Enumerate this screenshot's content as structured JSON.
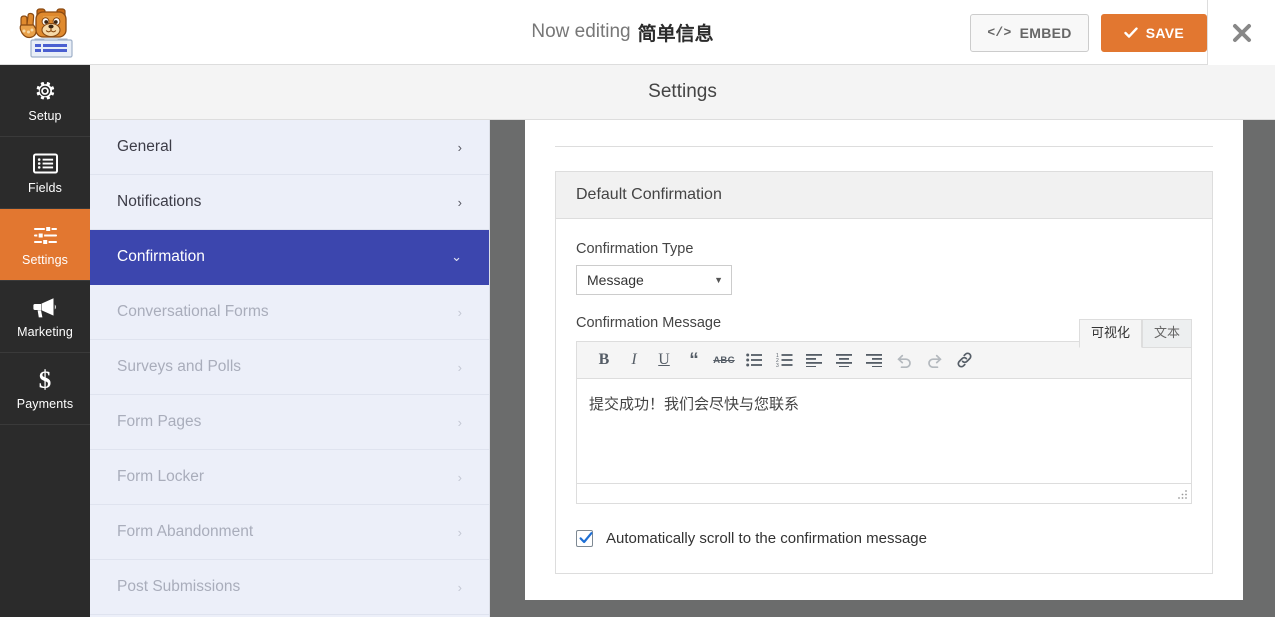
{
  "header": {
    "logo_icon": "wpforms-bear-logo",
    "editing_prefix": "Now editing",
    "form_name": "简单信息",
    "embed_label": "EMBED",
    "embed_icon": "code-icon",
    "save_label": "SAVE",
    "save_icon": "check-icon",
    "close_icon": "close-icon",
    "accent_color": "#e27730"
  },
  "rail": {
    "items": [
      {
        "label": "Setup",
        "icon": "gear-icon",
        "active": false
      },
      {
        "label": "Fields",
        "icon": "list-icon",
        "active": false
      },
      {
        "label": "Settings",
        "icon": "sliders-icon",
        "active": true
      },
      {
        "label": "Marketing",
        "icon": "megaphone-icon",
        "active": false
      },
      {
        "label": "Payments",
        "icon": "dollar-icon",
        "active": false
      }
    ]
  },
  "settings_header": {
    "title": "Settings"
  },
  "settings_menu": {
    "active_color": "#3c46ae",
    "items": [
      {
        "label": "General",
        "state": "enabled",
        "chevron": "›"
      },
      {
        "label": "Notifications",
        "state": "enabled",
        "chevron": "›"
      },
      {
        "label": "Confirmation",
        "state": "active",
        "chevron": "⌄"
      },
      {
        "label": "Conversational Forms",
        "state": "disabled",
        "chevron": "›"
      },
      {
        "label": "Surveys and Polls",
        "state": "disabled",
        "chevron": "›"
      },
      {
        "label": "Form Pages",
        "state": "disabled",
        "chevron": "›"
      },
      {
        "label": "Form Locker",
        "state": "disabled",
        "chevron": "›"
      },
      {
        "label": "Form Abandonment",
        "state": "disabled",
        "chevron": "›"
      },
      {
        "label": "Post Submissions",
        "state": "disabled",
        "chevron": "›"
      }
    ]
  },
  "confirmation": {
    "card_title": "Default Confirmation",
    "type_label": "Confirmation Type",
    "type_value": "Message",
    "type_caret": "▼",
    "message_label": "Confirmation Message",
    "editor": {
      "tab_visual": "可视化",
      "tab_text": "文本",
      "active_tab": "可视化",
      "content": "提交成功！我们会尽快与您联系",
      "toolbar": [
        {
          "name": "bold-icon",
          "glyph": "B",
          "enabled": true
        },
        {
          "name": "italic-icon",
          "glyph": "I",
          "enabled": true
        },
        {
          "name": "underline-icon",
          "glyph": "U",
          "enabled": true
        },
        {
          "name": "blockquote-icon",
          "glyph": "“",
          "enabled": true
        },
        {
          "name": "strikethrough-icon",
          "glyph": "ABC",
          "enabled": true
        },
        {
          "name": "bulleted-list-icon",
          "glyph": "",
          "enabled": true
        },
        {
          "name": "numbered-list-icon",
          "glyph": "",
          "enabled": true
        },
        {
          "name": "align-left-icon",
          "glyph": "",
          "enabled": true
        },
        {
          "name": "align-center-icon",
          "glyph": "",
          "enabled": true
        },
        {
          "name": "align-right-icon",
          "glyph": "",
          "enabled": true
        },
        {
          "name": "undo-icon",
          "glyph": "",
          "enabled": false
        },
        {
          "name": "redo-icon",
          "glyph": "",
          "enabled": false
        },
        {
          "name": "link-icon",
          "glyph": "",
          "enabled": true
        }
      ]
    },
    "scroll_checkbox_label": "Automatically scroll to the confirmation message",
    "scroll_checkbox_checked": true
  }
}
